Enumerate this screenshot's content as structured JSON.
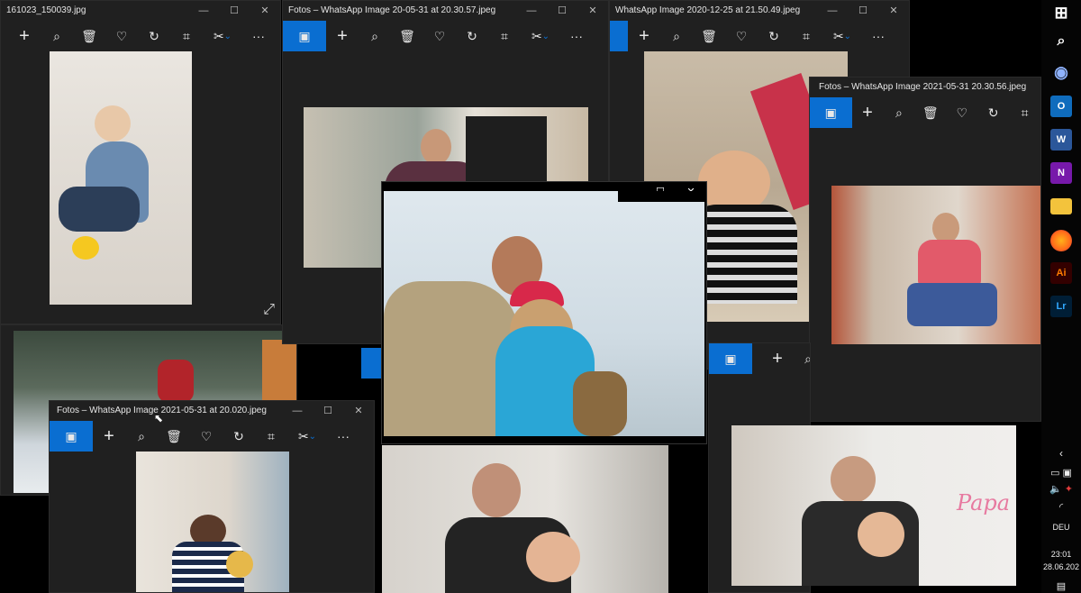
{
  "windows": {
    "w1": {
      "title": "161023_150039.jpg"
    },
    "w2": {
      "title": "Fotos – WhatsApp Image 20-05-31 at 20.30.57.jpeg"
    },
    "w3": {
      "title": "WhatsApp Image 2020-12-25 at 21.50.49.jpeg"
    },
    "w4": {
      "title": "Fotos – WhatsApp Image 2021-05-31 20.30.56.jpeg"
    },
    "w5": {
      "title": "Fotos – WhatsApp Image 2021-05-31 at 20.020.jpeg"
    }
  },
  "window_controls": {
    "minimize": "—",
    "maximize": "☐",
    "close": "✕"
  },
  "toolbar_icons": [
    "image-icon",
    "add-icon",
    "zoom-icon",
    "delete-icon",
    "favorite-icon",
    "rotate-icon",
    "crop-icon",
    "edit-icon",
    "more-icon"
  ],
  "toolbar_labels": {
    "add": "+",
    "more": "···",
    "chevron": "⌄"
  },
  "taskbar": {
    "apps": [
      {
        "name": "windows-start",
        "glyph": "⊞",
        "color": "#ffffff"
      },
      {
        "name": "search",
        "glyph": "⌕",
        "color": "#ffffff"
      },
      {
        "name": "user-profile",
        "glyph": "◉",
        "color": "#8fb3ff"
      },
      {
        "name": "outlook",
        "glyph": "O",
        "color": "#0f6cbd"
      },
      {
        "name": "word",
        "glyph": "W",
        "color": "#2b579a"
      },
      {
        "name": "onenote",
        "glyph": "N",
        "color": "#7719aa"
      },
      {
        "name": "file-explorer",
        "glyph": "▬",
        "color": "#f3c33c"
      },
      {
        "name": "firefox",
        "glyph": "●",
        "color": "#ff6b1a"
      },
      {
        "name": "illustrator",
        "glyph": "Ai",
        "color": "#ff7c00"
      },
      {
        "name": "lightroom",
        "glyph": "Lr",
        "color": "#31a8ff"
      }
    ],
    "language": "DEU",
    "time": "23:01",
    "date": "28.06.202"
  },
  "colors": {
    "accent": "#0a6ed1",
    "window_bg": "#202020",
    "desktop": "#000000"
  }
}
